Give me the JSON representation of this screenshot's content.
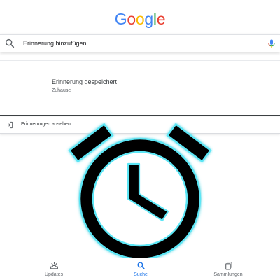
{
  "header": {
    "logo_letters": [
      {
        "char": "G",
        "color": "#4285F4"
      },
      {
        "char": "o",
        "color": "#EA4335"
      },
      {
        "char": "o",
        "color": "#FBBC05"
      },
      {
        "char": "g",
        "color": "#4285F4"
      },
      {
        "char": "l",
        "color": "#34A853"
      },
      {
        "char": "e",
        "color": "#EA4335"
      }
    ]
  },
  "search": {
    "query": "Erinnerung hinzufügen",
    "left_icon": "search-icon",
    "right_icon": "mic-icon"
  },
  "card": {
    "title": "Erinnerung gespeichert",
    "subtitle": "Zuhause"
  },
  "view_reminders": {
    "label": "Erinnerungen ansehen",
    "icon": "open-in-icon"
  },
  "illustration": {
    "icon": "alarm-clock-icon",
    "fill": "#000000",
    "glow": "#5ce6f5"
  },
  "bottom_nav": {
    "items": [
      {
        "label": "Updates",
        "icon": "updates-icon",
        "active": false
      },
      {
        "label": "Suche",
        "icon": "search-icon",
        "active": true
      },
      {
        "label": "Sammlungen",
        "icon": "collections-icon",
        "active": false
      }
    ],
    "active_color": "#1a73e8"
  }
}
